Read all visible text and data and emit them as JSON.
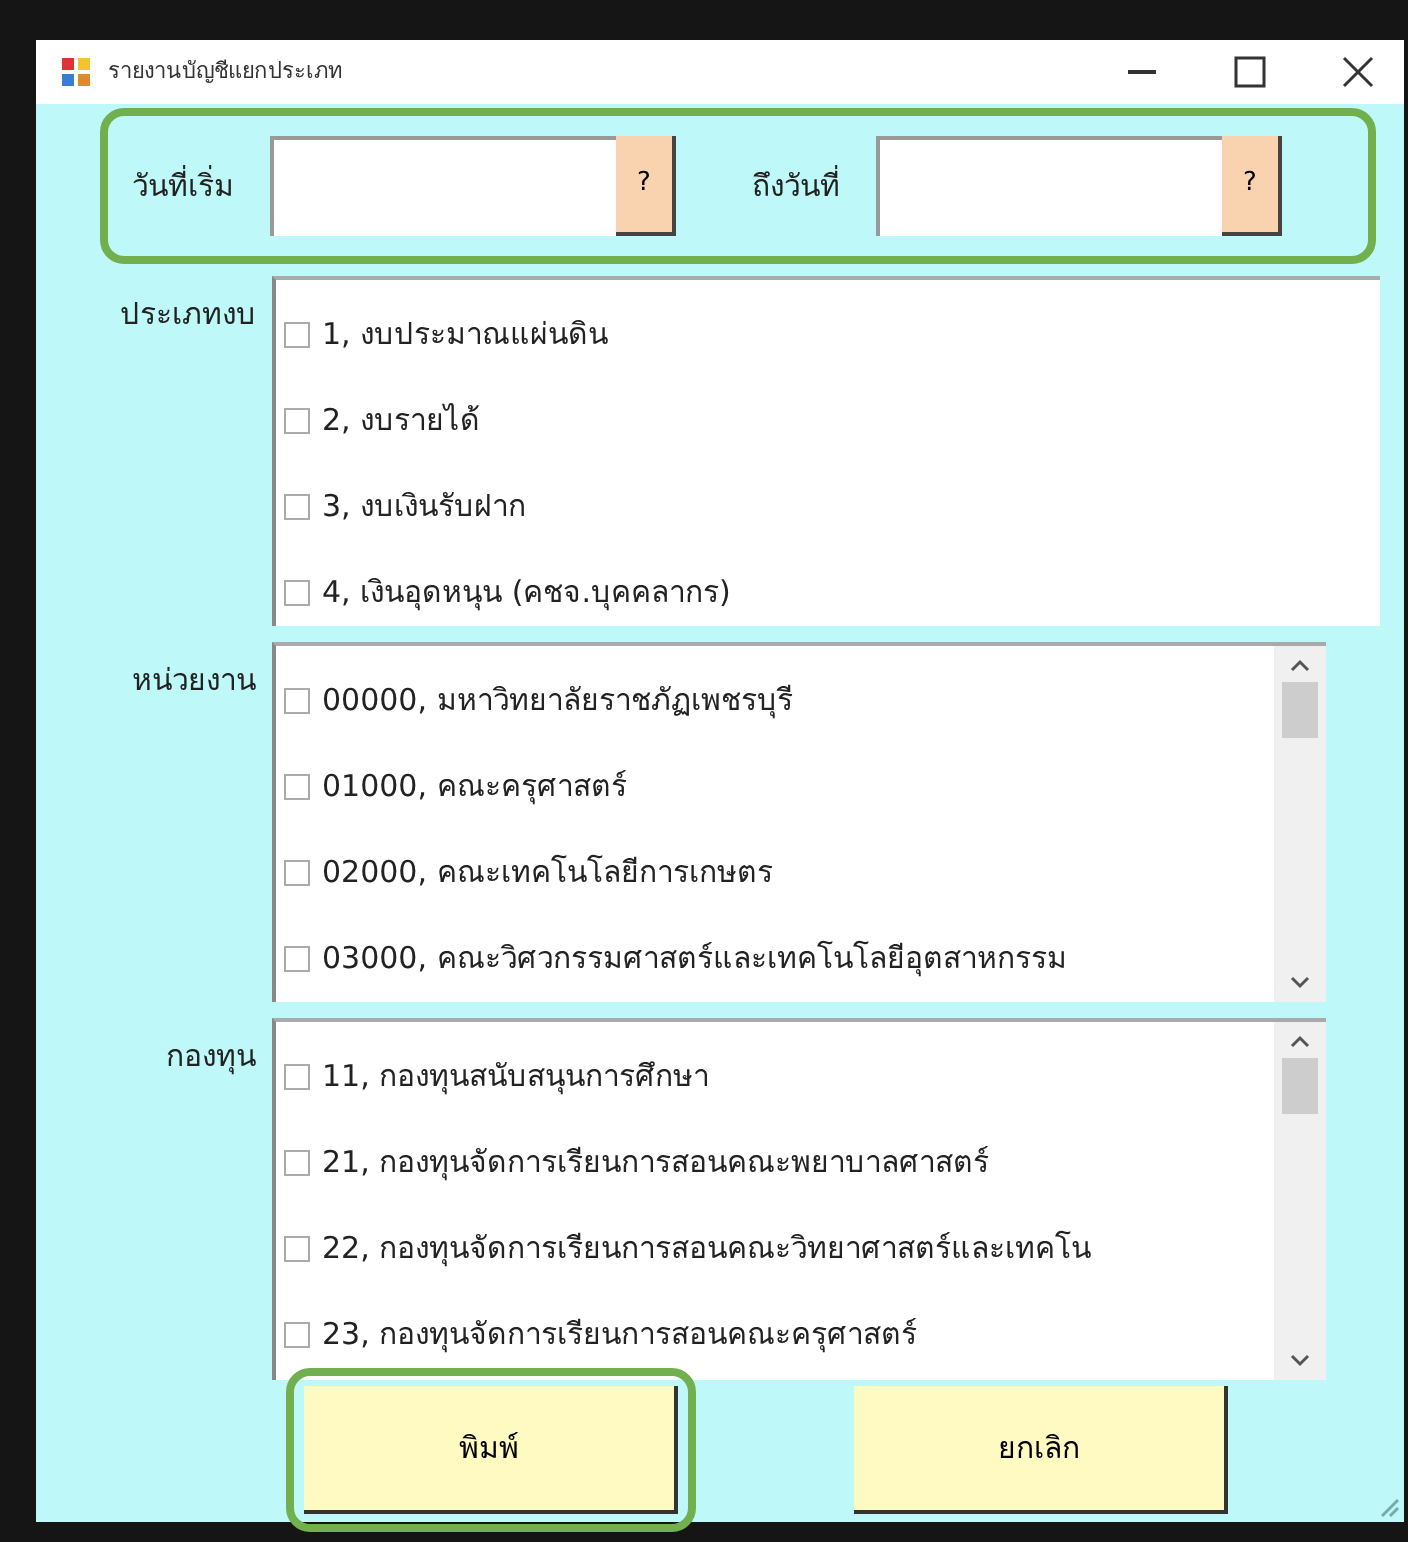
{
  "window": {
    "title": "รายงานบัญชีแยกประเภท"
  },
  "date_range": {
    "highlighted": true,
    "fields": [
      {
        "label": "วันที่เริ่ม",
        "button": "?"
      },
      {
        "label": "ถึงวันที่",
        "button": "?"
      }
    ]
  },
  "lists": [
    {
      "label": "ประเภทงบ",
      "scrollable": false,
      "items": [
        {
          "text": "1, งบประมาณแผ่นดิน",
          "checked": false
        },
        {
          "text": "2, งบรายได้",
          "checked": false
        },
        {
          "text": "3, งบเงินรับฝาก",
          "checked": false
        },
        {
          "text": "4, เงินอุดหนุน (คชจ.บุคคลากร)",
          "checked": false
        }
      ]
    },
    {
      "label": "หน่วยงาน",
      "scrollable": true,
      "items": [
        {
          "text": "00000, มหาวิทยาลัยราชภัฏเพชรบุรี",
          "checked": false
        },
        {
          "text": "01000, คณะครุศาสตร์",
          "checked": false
        },
        {
          "text": "02000, คณะเทคโนโลยีการเกษตร",
          "checked": false
        },
        {
          "text": "03000, คณะวิศวกรรมศาสตร์และเทคโนโลยีอุตสาหกรรม",
          "checked": false
        }
      ]
    },
    {
      "label": "กองทุน",
      "scrollable": true,
      "items": [
        {
          "text": "11, กองทุนสนับสนุนการศึกษา",
          "checked": false
        },
        {
          "text": "21, กองทุนจัดการเรียนการสอนคณะพยาบาลศาสตร์",
          "checked": false
        },
        {
          "text": "22, กองทุนจัดการเรียนการสอนคณะวิทยาศาสตร์และเทคโน",
          "checked": false
        },
        {
          "text": "23, กองทุนจัดการเรียนการสอนคณะครุศาสตร์",
          "checked": false
        }
      ]
    }
  ],
  "buttons": [
    {
      "label": "พิมพ์",
      "highlighted": true
    },
    {
      "label": "ยกเลิก",
      "highlighted": false
    }
  ]
}
